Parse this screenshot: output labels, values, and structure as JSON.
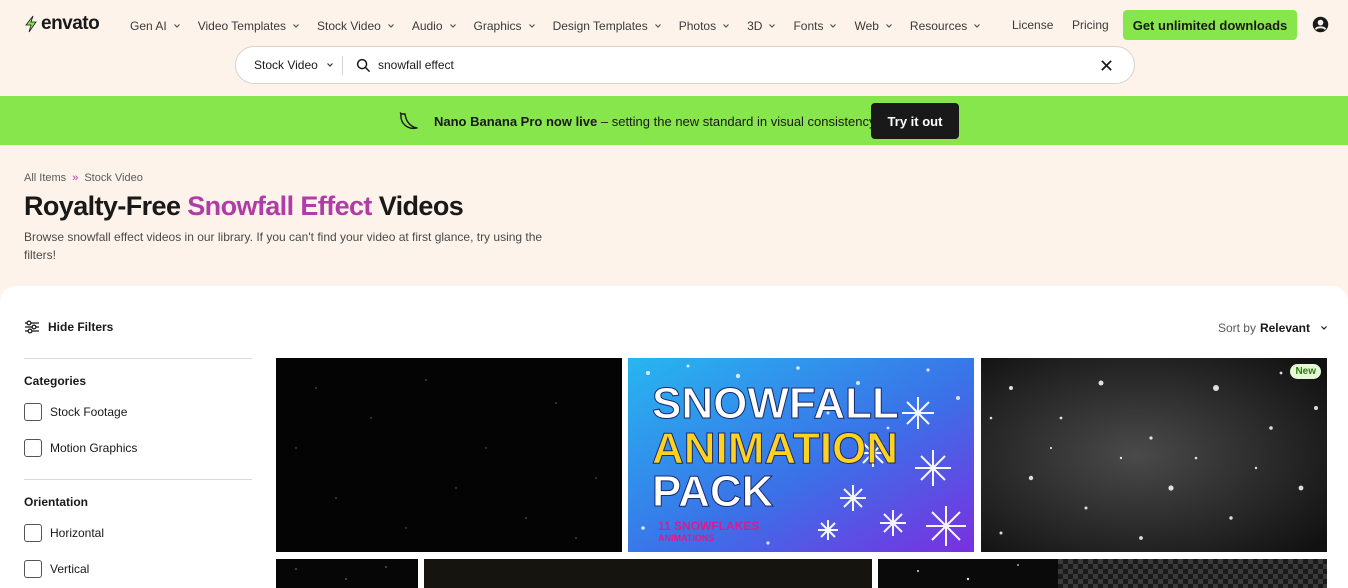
{
  "header": {
    "logo": "envato",
    "nav": [
      "Gen AI",
      "Video Templates",
      "Stock Video",
      "Audio",
      "Graphics",
      "Design Templates",
      "Photos",
      "3D",
      "Fonts",
      "Web",
      "Resources"
    ],
    "license": "License",
    "pricing": "Pricing",
    "cta": "Get unlimited downloads"
  },
  "search": {
    "category": "Stock Video",
    "query": "snowfall effect"
  },
  "banner": {
    "bold": "Nano Banana Pro now live",
    "text": " – setting the new standard in visual consistency.",
    "button": "Try it out"
  },
  "breadcrumb": {
    "home": "All Items",
    "sep": "»",
    "current": "Stock Video"
  },
  "page": {
    "title_pre": "Royalty-Free ",
    "title_hl": "Snowfall Effect",
    "title_post": " Videos",
    "description": "Browse snowfall effect videos in our library. If you can't find your video at first glance, try using the filters!"
  },
  "filters": {
    "toggle": "Hide Filters",
    "sort_label": "Sort by",
    "sort_value": "Relevant",
    "categories_heading": "Categories",
    "categories": [
      "Stock Footage",
      "Motion Graphics"
    ],
    "orientation_heading": "Orientation",
    "orientation": [
      "Horizontal",
      "Vertical"
    ]
  },
  "tiles": {
    "t2_line1": "SNOWFALL",
    "t2_line2": "ANIMATION",
    "t2_line3": "PACK",
    "t2_line4": "11 SNOWFLAKES",
    "t2_line5": "ANIMATIONS",
    "t3_badge": "New"
  },
  "colors": {
    "accent_green": "#87e64b",
    "highlight_purple": "#b03ca6",
    "cream": "#fdf3ea"
  }
}
